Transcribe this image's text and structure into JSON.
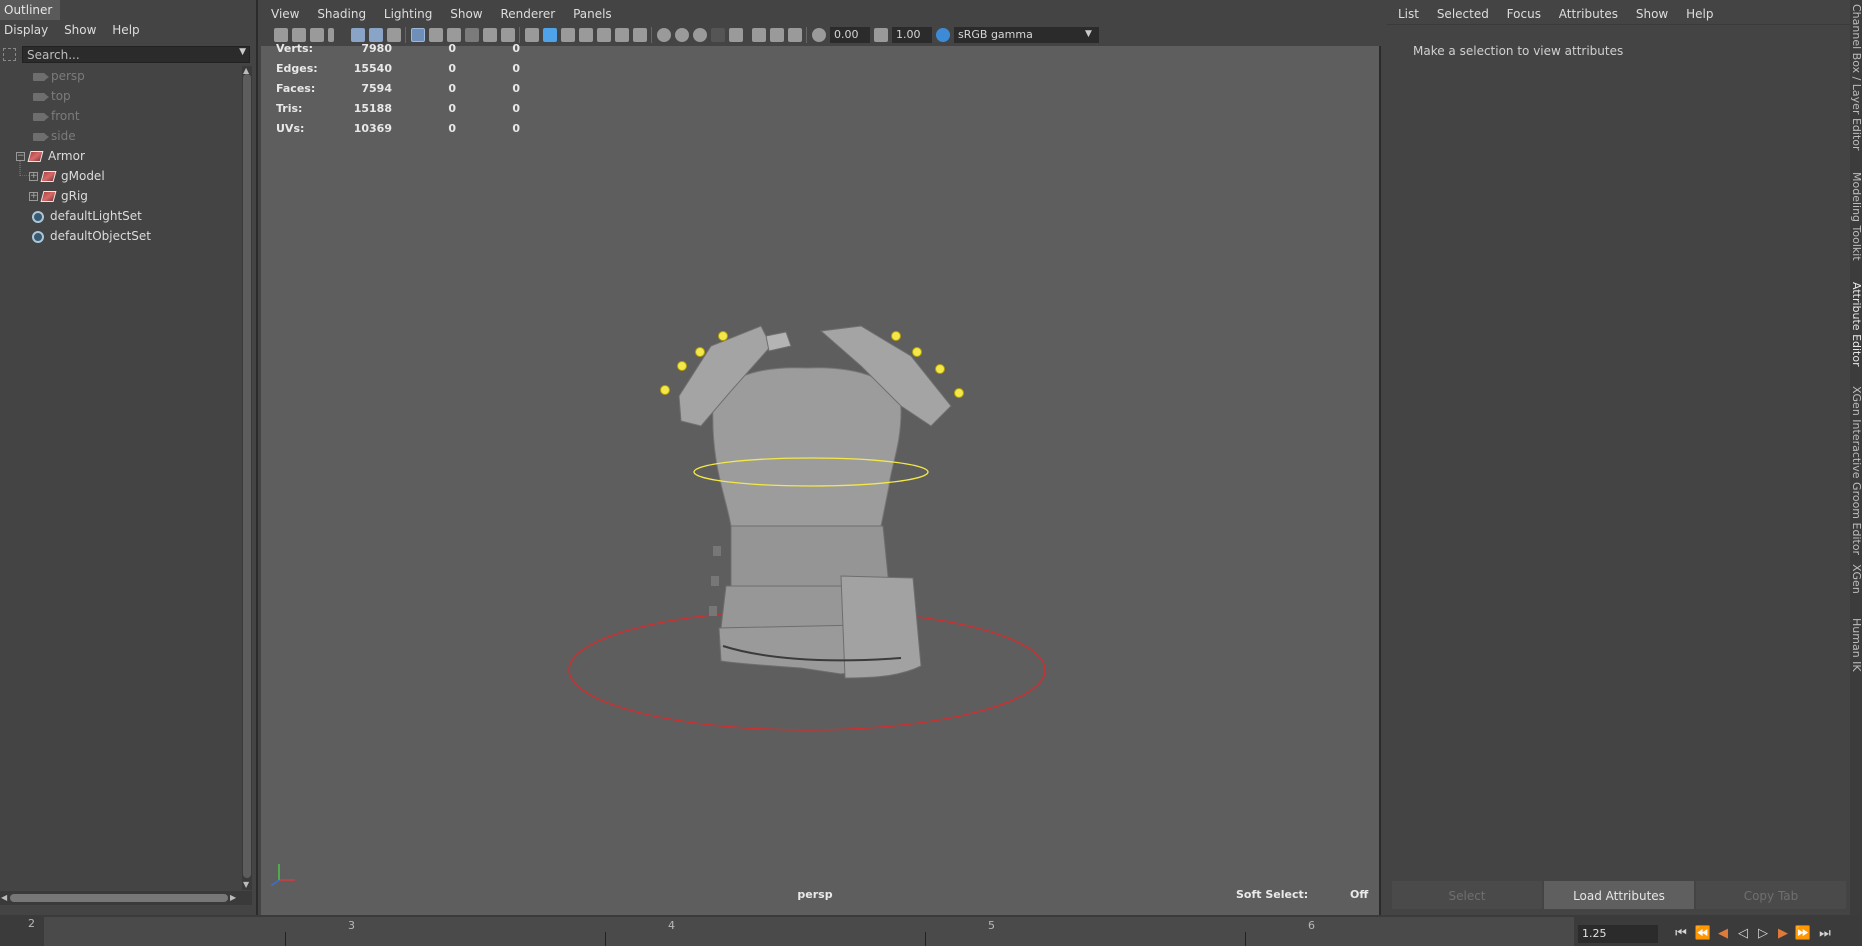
{
  "outliner": {
    "tab_title": "Outliner",
    "menu": [
      "Display",
      "Show",
      "Help"
    ],
    "search_placeholder": "Search...",
    "items": [
      {
        "label": "persp",
        "type": "camera"
      },
      {
        "label": "top",
        "type": "camera"
      },
      {
        "label": "front",
        "type": "camera"
      },
      {
        "label": "side",
        "type": "camera"
      },
      {
        "label": "Armor",
        "type": "group"
      },
      {
        "label": "gModel",
        "type": "group"
      },
      {
        "label": "gRig",
        "type": "group"
      },
      {
        "label": "defaultLightSet",
        "type": "set"
      },
      {
        "label": "defaultObjectSet",
        "type": "set"
      }
    ]
  },
  "viewport": {
    "menu": [
      "View",
      "Shading",
      "Lighting",
      "Show",
      "Renderer",
      "Panels"
    ],
    "toolbar": {
      "exposure": "0.00",
      "gamma": "1.00",
      "color_space": "sRGB gamma"
    },
    "hud": [
      {
        "label": "Verts:",
        "v1": "7980",
        "v2": "0",
        "v3": "0"
      },
      {
        "label": "Edges:",
        "v1": "15540",
        "v2": "0",
        "v3": "0"
      },
      {
        "label": "Faces:",
        "v1": "7594",
        "v2": "0",
        "v3": "0"
      },
      {
        "label": "Tris:",
        "v1": "15188",
        "v2": "0",
        "v3": "0"
      },
      {
        "label": "UVs:",
        "v1": "10369",
        "v2": "0",
        "v3": "0"
      }
    ],
    "camera_label": "persp",
    "soft_select_label": "Soft Select:",
    "soft_select_value": "Off",
    "colors": {
      "background": "#5e5e5e",
      "rig_ring": "#f2e84a",
      "root_ring": "#c83232"
    }
  },
  "attribute_editor": {
    "menu": [
      "List",
      "Selected",
      "Focus",
      "Attributes",
      "Show",
      "Help"
    ],
    "message": "Make a selection to view attributes",
    "buttons": [
      "Select",
      "Load Attributes",
      "Copy Tab"
    ]
  },
  "side_tabs": [
    "Channel Box / Layer Editor",
    "Modeling Toolkit",
    "Attribute Editor",
    "XGen Interactive Groom Editor",
    "XGen",
    "Human IK"
  ],
  "timeline": {
    "tick_labels": [
      "2",
      "3",
      "4",
      "5",
      "6"
    ],
    "current_frame": "1.25"
  }
}
